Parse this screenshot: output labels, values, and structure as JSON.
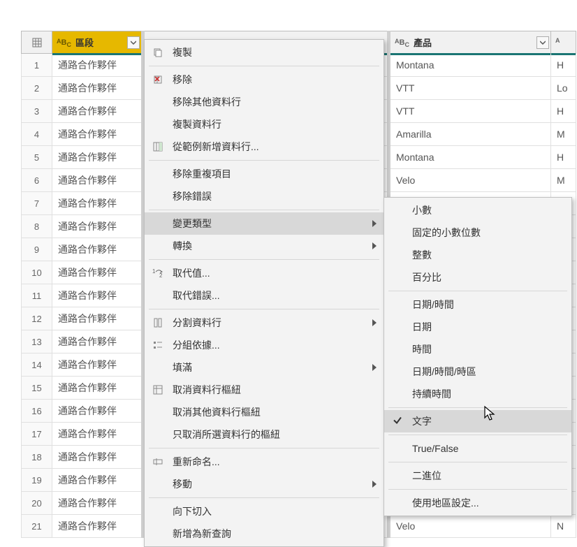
{
  "columns": {
    "segment": "區段",
    "product": "產品"
  },
  "rows": [
    {
      "n": "1",
      "seg": "通路合作夥伴",
      "prod": "Montana",
      "last": "H"
    },
    {
      "n": "2",
      "seg": "通路合作夥伴",
      "prod": "VTT",
      "last": "Lo"
    },
    {
      "n": "3",
      "seg": "通路合作夥伴",
      "prod": "VTT",
      "last": "H"
    },
    {
      "n": "4",
      "seg": "通路合作夥伴",
      "prod": "Amarilla",
      "last": "M"
    },
    {
      "n": "5",
      "seg": "通路合作夥伴",
      "prod": "Montana",
      "last": "H"
    },
    {
      "n": "6",
      "seg": "通路合作夥伴",
      "prod": "Velo",
      "last": "M"
    },
    {
      "n": "7",
      "seg": "通路合作夥伴",
      "prod": "",
      "last": ""
    },
    {
      "n": "8",
      "seg": "通路合作夥伴",
      "prod": "",
      "last": ""
    },
    {
      "n": "9",
      "seg": "通路合作夥伴",
      "prod": "",
      "last": ""
    },
    {
      "n": "10",
      "seg": "通路合作夥伴",
      "prod": "",
      "last": ""
    },
    {
      "n": "11",
      "seg": "通路合作夥伴",
      "prod": "",
      "last": ""
    },
    {
      "n": "12",
      "seg": "通路合作夥伴",
      "prod": "",
      "last": ""
    },
    {
      "n": "13",
      "seg": "通路合作夥伴",
      "prod": "",
      "last": ""
    },
    {
      "n": "14",
      "seg": "通路合作夥伴",
      "prod": "",
      "last": ""
    },
    {
      "n": "15",
      "seg": "通路合作夥伴",
      "prod": "",
      "last": ""
    },
    {
      "n": "16",
      "seg": "通路合作夥伴",
      "prod": "",
      "last": ""
    },
    {
      "n": "17",
      "seg": "通路合作夥伴",
      "prod": "",
      "last": ""
    },
    {
      "n": "18",
      "seg": "通路合作夥伴",
      "prod": "",
      "last": ""
    },
    {
      "n": "19",
      "seg": "通路合作夥伴",
      "prod": "",
      "last": ""
    },
    {
      "n": "20",
      "seg": "通路合作夥伴",
      "prod": "",
      "last": ""
    },
    {
      "n": "21",
      "seg": "通路合作夥伴",
      "prod": "Velo",
      "last": "N"
    }
  ],
  "menu": {
    "copy": "複製",
    "remove": "移除",
    "remove_other": "移除其他資料行",
    "dup_col": "複製資料行",
    "add_from_example": "從範例新增資料行...",
    "remove_dup": "移除重複項目",
    "remove_err": "移除錯誤",
    "change_type": "變更類型",
    "transform": "轉換",
    "replace_val": "取代值...",
    "replace_err": "取代錯誤...",
    "split_col": "分割資料行",
    "group_by": "分組依據...",
    "fill": "填滿",
    "unpivot": "取消資料行樞紐",
    "unpivot_other": "取消其他資料行樞紐",
    "unpivot_sel": "只取消所選資料行的樞紐",
    "rename": "重新命名...",
    "move": "移動",
    "drill": "向下切入",
    "add_query": "新增為新查詢"
  },
  "submenu": {
    "decimal": "小數",
    "fixed_decimal": "固定的小數位數",
    "integer": "整數",
    "percent": "百分比",
    "datetime": "日期/時間",
    "date": "日期",
    "time": "時間",
    "dtz": "日期/時間/時區",
    "duration": "持續時間",
    "text": "文字",
    "truefalse": "True/False",
    "binary": "二進位",
    "locale": "使用地區設定..."
  }
}
